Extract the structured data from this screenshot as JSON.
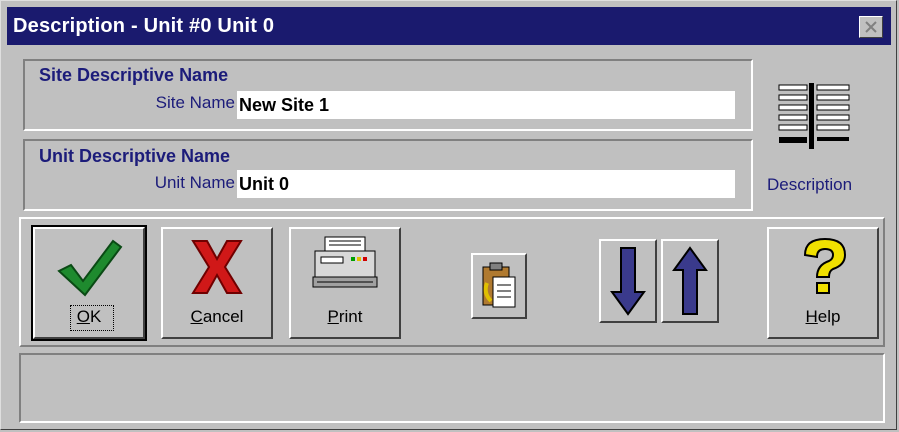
{
  "window": {
    "title": "Description - Unit #0 Unit 0"
  },
  "site_group": {
    "title": "Site Descriptive Name",
    "label": "Site Name",
    "value": "New Site 1"
  },
  "unit_group": {
    "title": "Unit Descriptive Name",
    "label": "Unit Name",
    "value": "Unit 0"
  },
  "side_panel": {
    "icon": "description-icon",
    "label": "Description"
  },
  "buttons": {
    "ok": {
      "label": "OK",
      "mnemonic": "O",
      "rest": "K",
      "icon": "checkmark-icon"
    },
    "cancel": {
      "label": "Cancel",
      "mnemonic": "C",
      "rest": "ancel",
      "icon": "red-x-icon"
    },
    "print": {
      "label": "Print",
      "mnemonic": "P",
      "rest": "rint",
      "icon": "printer-icon"
    },
    "clipboard": {
      "icon": "clipboard-icon"
    },
    "down": {
      "icon": "arrow-down-icon"
    },
    "up": {
      "icon": "arrow-up-icon"
    },
    "help": {
      "label": "Help",
      "mnemonic": "H",
      "rest": "elp",
      "icon": "question-mark-icon"
    }
  },
  "colors": {
    "titlebar": "#1a1a6e",
    "label_text": "#1c1c7a",
    "face": "#c0c0c0",
    "arrow_blue": "#3a3a8c",
    "check_green": "#1e8a2e",
    "x_red": "#d01818",
    "help_yellow": "#f0e000"
  },
  "status_bar": {
    "text": ""
  }
}
